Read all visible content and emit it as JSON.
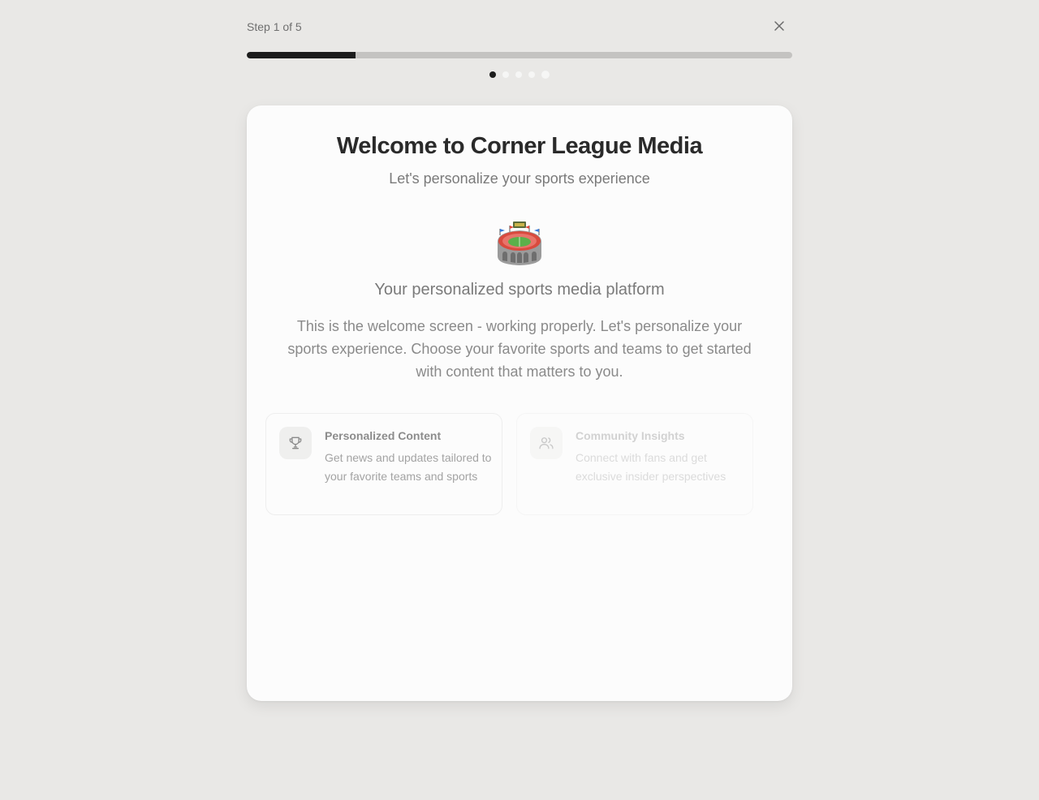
{
  "header": {
    "step_label": "Step 1 of 5",
    "close_icon": "close-icon",
    "progress": 0.2,
    "total_steps": 5,
    "current_step": 1
  },
  "card": {
    "title": "Welcome to Corner League Media",
    "subtitle": "Let's personalize your sports experience",
    "hero_icon": "stadium-icon",
    "tagline": "Your personalized sports media platform",
    "description": "This is the welcome screen - working properly. Let's personalize your sports experience. Choose your favorite sports and teams to get started with content that matters to you."
  },
  "features": [
    {
      "icon": "trophy-icon",
      "title": "Personalized Content",
      "description": "Get news and updates tailored to your favorite teams and sports"
    },
    {
      "icon": "users-icon",
      "title": "Community Insights",
      "description": "Connect with fans and get exclusive insider perspectives"
    }
  ],
  "colors": {
    "background": "#e9e8e6",
    "card": "#fcfcfc",
    "progress_fill": "#1c1c1c",
    "progress_track": "#c4c3c1"
  }
}
